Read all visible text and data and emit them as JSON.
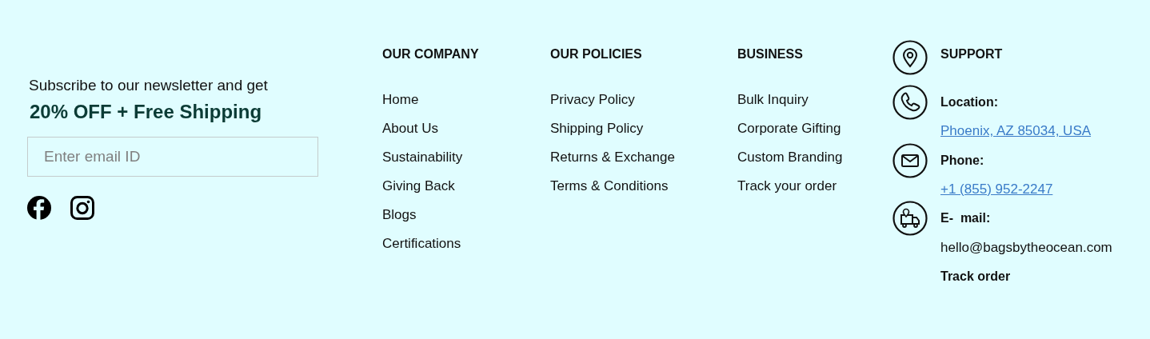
{
  "newsletter": {
    "intro": "Subscribe to our newsletter and get",
    "offer": "20% OFF + Free Shipping",
    "email_field": {
      "placeholder": "Enter email ID"
    }
  },
  "columns": [
    {
      "title": "OUR COMPANY",
      "links": [
        "Home",
        "About Us",
        "Sustainability",
        "Giving Back",
        "Blogs",
        "Certifications"
      ]
    },
    {
      "title": "OUR POLICIES",
      "links": [
        "Privacy Policy",
        "Shipping Policy",
        "Returns & Exchange",
        "Terms & Conditions"
      ]
    },
    {
      "title": "BUSINESS",
      "links": [
        "Bulk Inquiry",
        "Corporate Gifting",
        "Custom Branding",
        "Track your order"
      ]
    }
  ],
  "support": {
    "rows": [
      {
        "kind": "heading",
        "text": "SUPPORT"
      },
      {
        "kind": "label",
        "text": "Location:"
      },
      {
        "kind": "link",
        "text": "Phoenix, AZ 85034, USA"
      },
      {
        "kind": "label",
        "text": "Phone:"
      },
      {
        "kind": "link",
        "text": "+1 (855) 952-2247"
      },
      {
        "kind": "label",
        "text": "E-  mail:"
      },
      {
        "kind": "text",
        "text": "hello@bagsbytheocean.com"
      },
      {
        "kind": "bold-link",
        "text": "Track order"
      }
    ]
  }
}
